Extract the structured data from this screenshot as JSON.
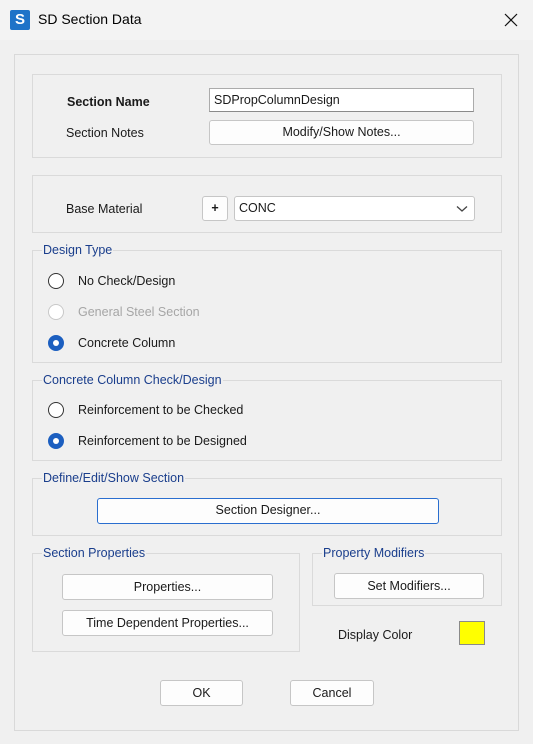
{
  "window": {
    "title": "SD Section Data",
    "icon_letter": "S"
  },
  "section": {
    "name_label": "Section Name",
    "name_value": "SDPropColumnDesign",
    "notes_label": "Section Notes",
    "notes_button": "Modify/Show Notes..."
  },
  "material": {
    "label": "Base Material",
    "add_button": "+",
    "selected": "CONC"
  },
  "design_type": {
    "title": "Design Type",
    "options": [
      {
        "label": "No Check/Design",
        "checked": false,
        "disabled": false
      },
      {
        "label": "General Steel Section",
        "checked": false,
        "disabled": true
      },
      {
        "label": "Concrete Column",
        "checked": true,
        "disabled": false
      }
    ]
  },
  "concrete_check": {
    "title": "Concrete Column Check/Design",
    "options": [
      {
        "label": "Reinforcement to be Checked",
        "checked": false
      },
      {
        "label": "Reinforcement to be Designed",
        "checked": true
      }
    ]
  },
  "define_section": {
    "title": "Define/Edit/Show Section",
    "button": "Section Designer..."
  },
  "properties": {
    "title": "Section Properties",
    "properties_button": "Properties...",
    "time_button": "Time Dependent Properties..."
  },
  "modifiers": {
    "title": "Property Modifiers",
    "button": "Set Modifiers..."
  },
  "display_color": {
    "label": "Display Color",
    "color": "#ffff00"
  },
  "footer": {
    "ok": "OK",
    "cancel": "Cancel"
  }
}
